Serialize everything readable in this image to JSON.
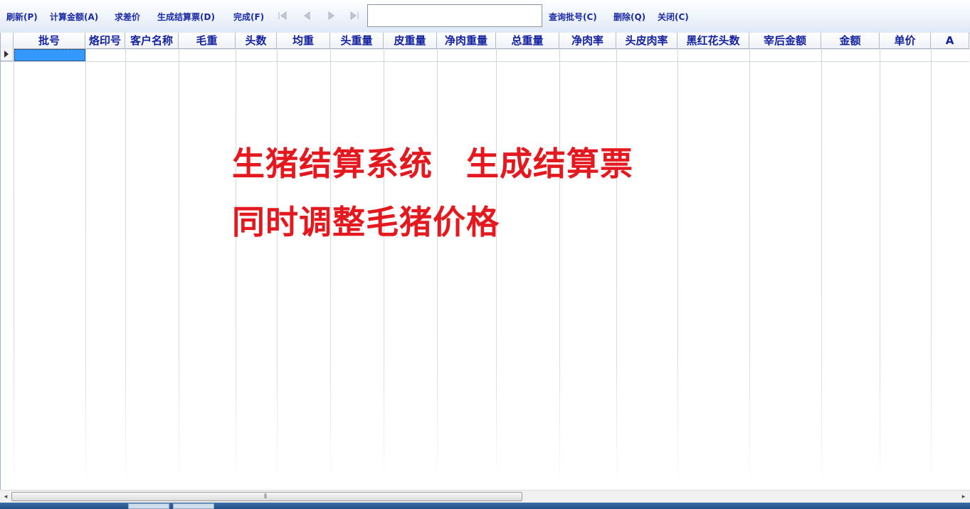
{
  "toolbar": {
    "refresh": "刷新(P)",
    "calc_amount": "计算金额(A)",
    "price_diff": "求差价",
    "generate_ticket": "生成结算票(D)",
    "complete": "完成(F)",
    "search_value": "",
    "query_batch": "查询批号(C)",
    "delete": "删除(Q)",
    "close": "关闭(C)"
  },
  "nav_icons": [
    "first-record-icon",
    "previous-record-icon",
    "next-record-icon",
    "last-record-icon"
  ],
  "columns": [
    "批号",
    "烙印号",
    "客户名称",
    "毛重",
    "头数",
    "均重",
    "头重量",
    "皮重量",
    "净肉重量",
    "总重量",
    "净肉率",
    "头皮肉率",
    "黑红花头数",
    "宰后金额",
    "金额",
    "单价",
    "A"
  ],
  "overlay": {
    "line1": "生猪结算系统　生成结算票",
    "line2": "同时调整毛猪价格",
    "color": "#e3191f"
  },
  "scrollbar": {
    "left_arrow": "◂",
    "right_arrow": "▸",
    "grip": "⦀"
  },
  "colors": {
    "header_text": "#1422a0",
    "toolbar_text": "#1a2aa8",
    "selection": "#3399ff"
  }
}
